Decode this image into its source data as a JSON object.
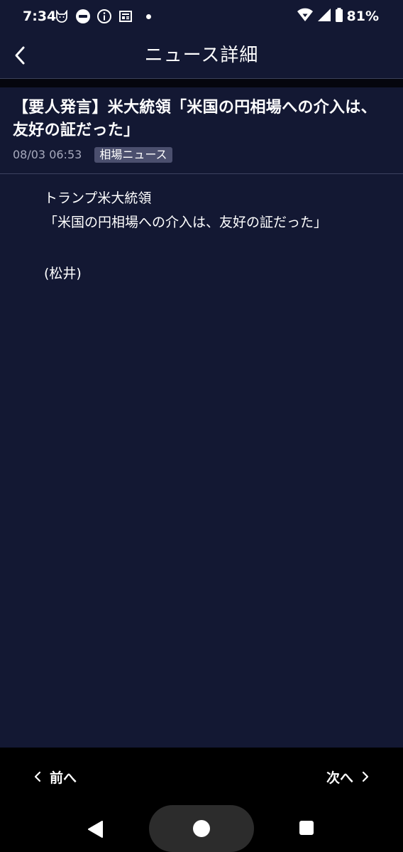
{
  "status_bar": {
    "time": "7:34",
    "battery": "81%",
    "icons": [
      "cat-face-icon",
      "nhk-app-icon",
      "info-icon",
      "news-icon",
      "dot-icon",
      "wifi-icon",
      "signal-icon",
      "battery-icon"
    ]
  },
  "header": {
    "title": "ニュース詳細",
    "back_icon": "chevron-left-icon"
  },
  "article": {
    "title": "【要人発言】米大統領「米国の円相場への介入は、友好の証だった」",
    "date": "08/03 06:53",
    "category": "相場ニュース",
    "body": {
      "line1": "トランプ米大統領",
      "line2": "「米国の円相場への介入は、友好の証だった」",
      "author": "(松井)"
    }
  },
  "bottom_nav": {
    "prev_label": "前へ",
    "next_label": "次へ"
  },
  "colors": {
    "background": "#131833",
    "badge": "#4b4f6e",
    "date_text": "#a7aabd",
    "bottom_nav": "#000000"
  }
}
